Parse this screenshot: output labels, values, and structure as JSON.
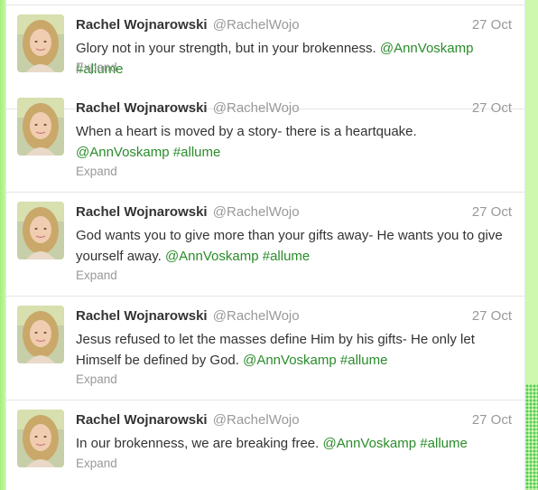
{
  "timeline": {
    "tweets": [
      {
        "name": "Rachel Wojnarowski",
        "handle": "@RachelWojo",
        "date": "27 Oct",
        "text": "Glory not in your strength, but in your brokenness.",
        "mention": "@AnnVoskamp",
        "hashtag": "#allume",
        "expand": "Expand"
      },
      {
        "name": "Rachel Wojnarowski",
        "handle": "@RachelWojo",
        "date": "27 Oct",
        "text": "When a heart is moved by a story- there is a heartquake.",
        "mention": "@AnnVoskamp",
        "hashtag": "#allume",
        "expand": "Expand"
      },
      {
        "name": "Rachel Wojnarowski",
        "handle": "@RachelWojo",
        "date": "27 Oct",
        "text": "God wants you to give more than your gifts away- He wants you to give yourself away.",
        "mention": "@AnnVoskamp",
        "hashtag": "#allume",
        "expand": "Expand"
      },
      {
        "name": "Rachel Wojnarowski",
        "handle": "@RachelWojo",
        "date": "27 Oct",
        "text": "Jesus refused to let the masses define Him by his gifts- He only let Himself be defined by God.",
        "mention": "@AnnVoskamp",
        "hashtag": "#allume",
        "expand": "Expand"
      },
      {
        "name": "Rachel Wojnarowski",
        "handle": "@RachelWojo",
        "date": "27 Oct",
        "text": "In our brokenness, we are breaking free.",
        "mention": "@AnnVoskamp",
        "hashtag": "#allume",
        "expand": "Expand"
      }
    ]
  },
  "colors": {
    "page_background": "#b9f58e",
    "link": "#2a8c2a",
    "name": "#333333",
    "muted": "#999999"
  }
}
